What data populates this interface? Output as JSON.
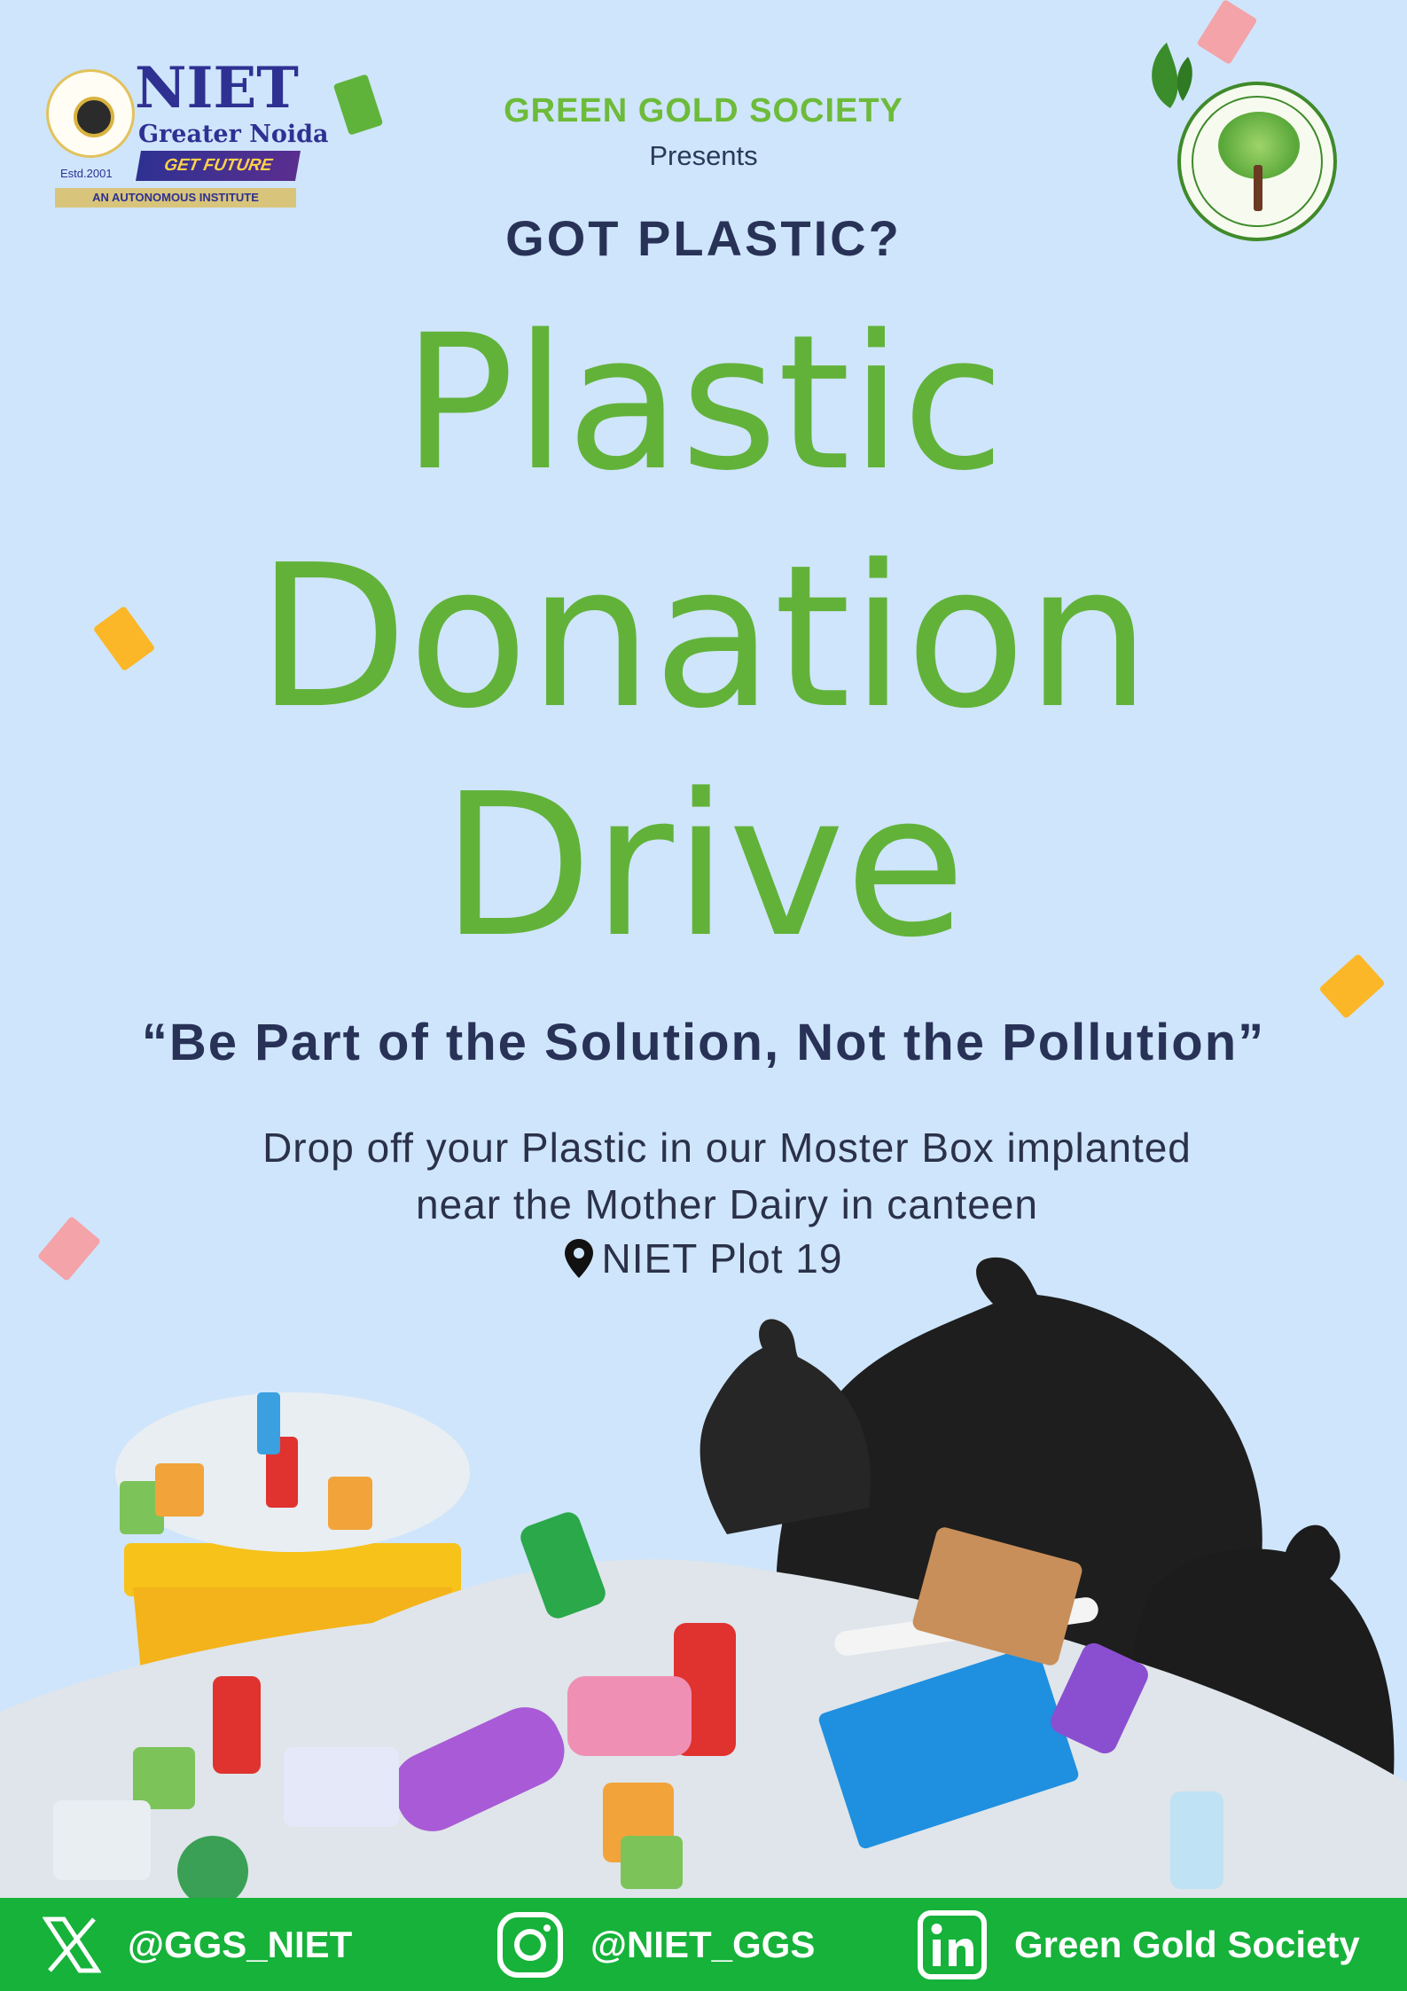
{
  "header": {
    "niet_logo": {
      "name": "NIET",
      "city": "Greater Noida",
      "tagline": "GET FUTURE READY",
      "established": "Estd.2001",
      "status": "AN AUTONOMOUS INSTITUTE"
    },
    "society_name": "GREEN GOLD SOCIETY",
    "presents": "Presents",
    "seal_icon": "green-gold-society-tree-seal"
  },
  "headline": {
    "kicker": "GOT PLASTIC?",
    "title_line_1": "Plastic",
    "title_line_2": "Donation",
    "title_line_3": "Drive"
  },
  "slogan": "“Be Part of the Solution, Not the Pollution”",
  "details": {
    "drop_off_line_1": "Drop off your Plastic in our Moster Box implanted",
    "drop_off_line_2": "near the Mother Dairy in canteen",
    "location_icon": "map-pin-icon",
    "location": "NIET Plot 19"
  },
  "illustration": "plastic-waste-pile",
  "footer": {
    "x_handle": "@GGS_NIET",
    "instagram_handle": "@NIET_GGS",
    "linkedin_name": "Green Gold Society"
  },
  "colors": {
    "background": "#cfe5fb",
    "title_green": "#62b23a",
    "navy_text": "#283257",
    "footer_green": "#16b23a"
  }
}
